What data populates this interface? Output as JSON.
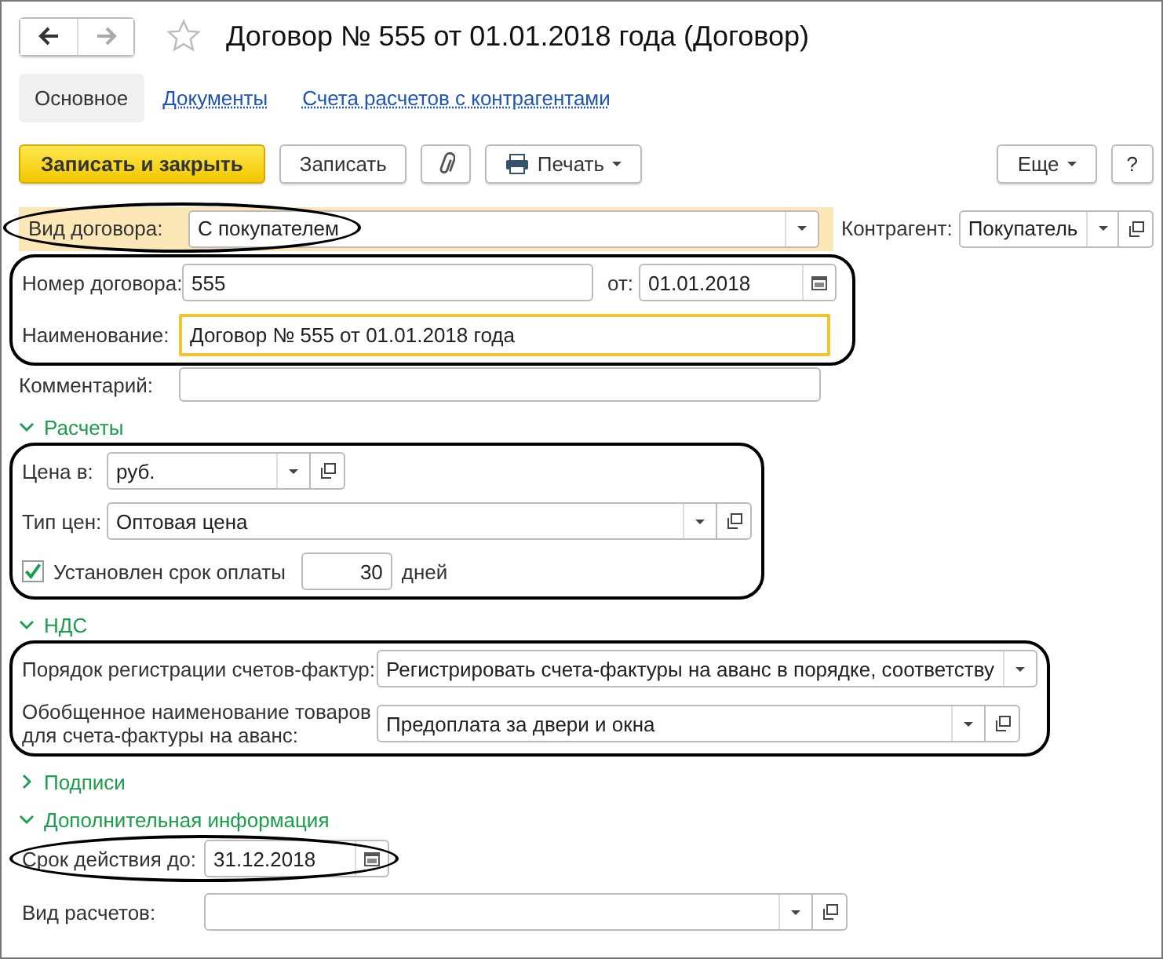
{
  "nav_buttons": [
    {
      "kind": "back",
      "disabled": false
    },
    {
      "kind": "forward",
      "disabled": true
    }
  ],
  "window": {
    "title": "Договор № 555 от 01.01.2018 года (Договор)"
  },
  "tabs": [
    {
      "label": "Основное",
      "selected": true
    },
    {
      "label": "Документы",
      "selected": false
    },
    {
      "label": "Счета расчетов с контрагентами",
      "selected": false
    }
  ],
  "toolbar": {
    "left": [
      {
        "kind": "primary",
        "label": "Записать и закрыть"
      },
      {
        "kind": "save",
        "label": "Записать"
      },
      {
        "kind": "attach"
      },
      {
        "kind": "print",
        "label": "Печать",
        "dropdown": true
      }
    ],
    "right": [
      {
        "kind": "more",
        "label": "Еще",
        "dropdown": true
      },
      {
        "kind": "help",
        "label": "?"
      }
    ]
  },
  "contract_type": {
    "label": "Вид договора:",
    "value": "С покупателем",
    "highlighted": true
  },
  "counterparty": {
    "label": "Контрагент:",
    "value": "Покупатель"
  },
  "main_group": {
    "highlighted": true,
    "number": {
      "label": "Номер договора:",
      "value": "555"
    },
    "date": {
      "label": "от:",
      "value": "01.01.2018"
    },
    "name": {
      "label": "Наименование:",
      "value": "Договор № 555 от 01.01.2018 года",
      "focused": true
    }
  },
  "comment": {
    "label": "Комментарий:"
  },
  "sections": [
    {
      "title": "Расчеты",
      "expanded": true,
      "highlighted": true,
      "fields": [
        {
          "kind": "select",
          "label": "Цена в:",
          "value": "руб.",
          "open": true
        },
        {
          "kind": "select",
          "label": "Тип цен:",
          "value": "Оптовая цена",
          "open": true
        },
        {
          "kind": "checkbox",
          "label": "Установлен срок оплаты",
          "checked": true,
          "value": "30",
          "unit": "дней"
        }
      ]
    },
    {
      "title": "НДС",
      "expanded": true,
      "highlighted": true,
      "fields": [
        {
          "kind": "select",
          "label": "Порядок регистрации счетов-фактур:",
          "value": "Регистрировать счета-фактуры на аванс в порядке, соответству",
          "open": false
        },
        {
          "kind": "select",
          "label": "Обобщенное наименование товаров для счета-фактуры на аванс:",
          "value": "Предоплата за двери и окна",
          "open": true
        }
      ]
    },
    {
      "title": "Подписи",
      "expanded": false
    },
    {
      "title": "Дополнительная информация",
      "expanded": true,
      "highlighted": false,
      "fields": [
        {
          "kind": "date",
          "label": "Срок действия до:",
          "value": "31.12.2018",
          "highlighted": true
        },
        {
          "kind": "select",
          "label": "Вид расчетов:",
          "open": true
        }
      ]
    }
  ]
}
